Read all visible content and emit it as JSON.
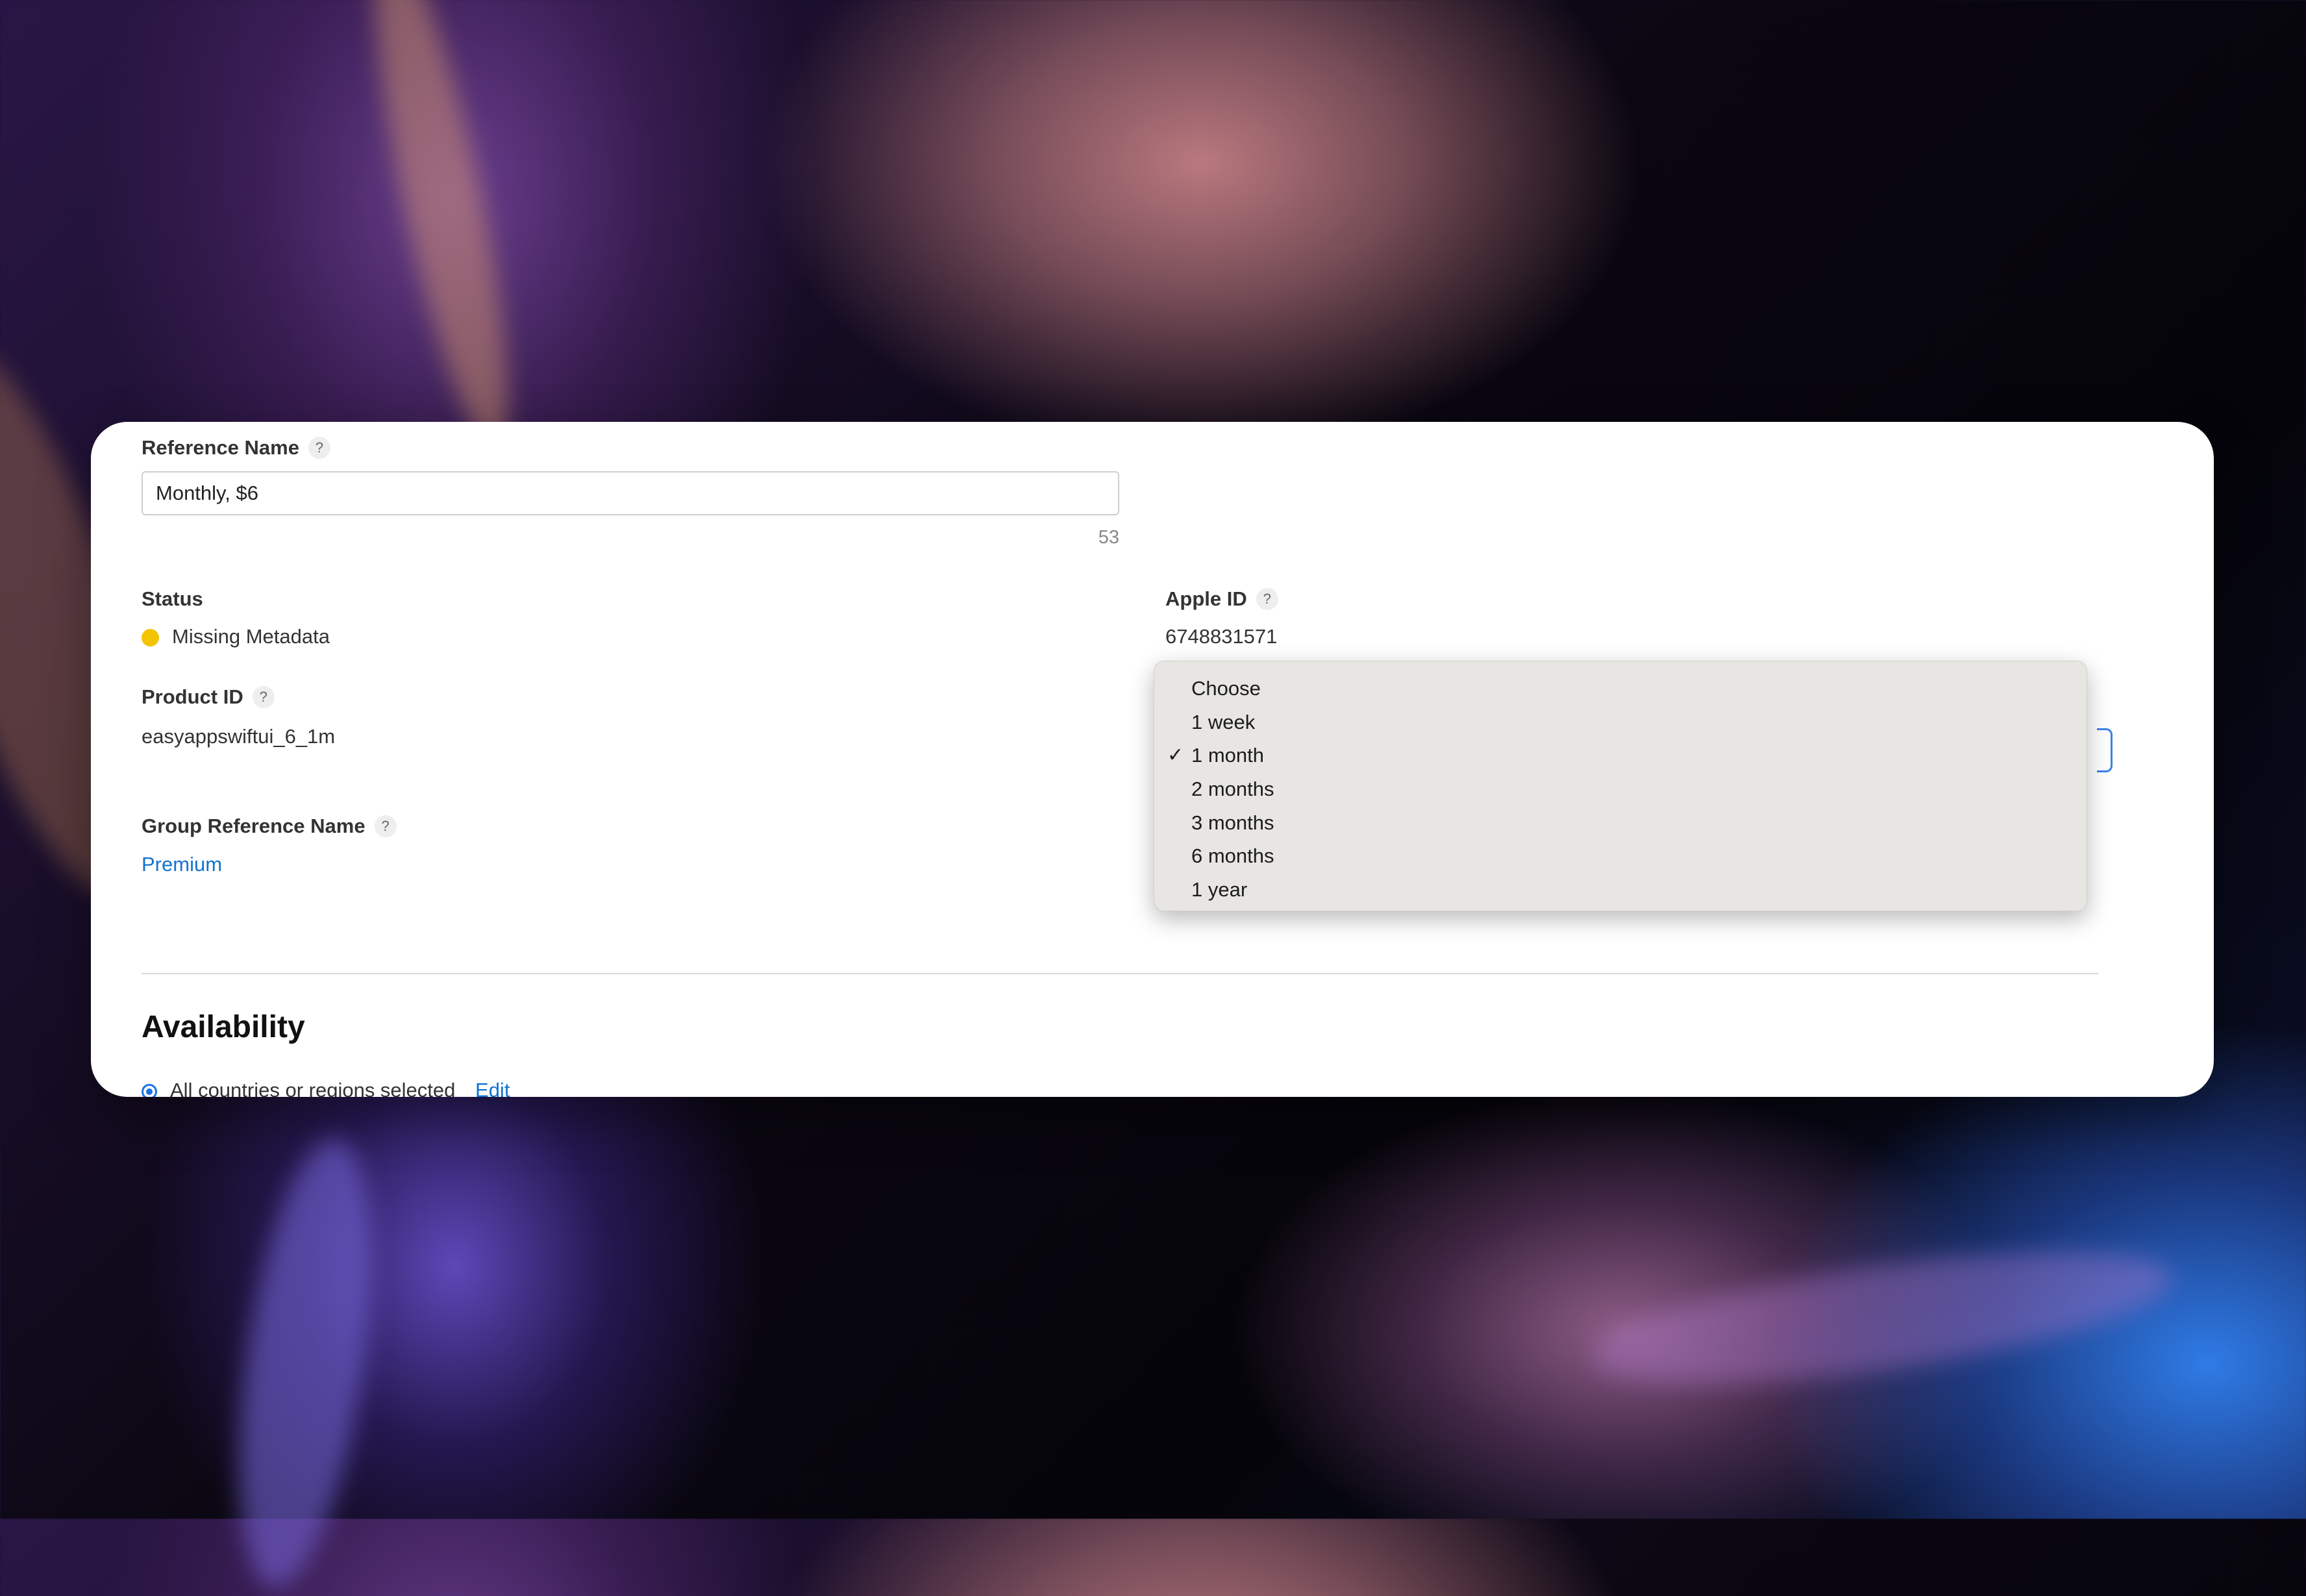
{
  "form": {
    "reference_name": {
      "label": "Reference Name",
      "value": "Monthly, $6",
      "counter": "53"
    },
    "status": {
      "label": "Status",
      "value": "Missing Metadata",
      "color": "#f5c400"
    },
    "apple_id": {
      "label": "Apple ID",
      "value": "6748831571"
    },
    "product_id": {
      "label": "Product ID",
      "value": "easyappswiftui_6_1m"
    },
    "group_reference_name": {
      "label": "Group Reference Name",
      "value": "Premium"
    },
    "help_glyph": "?"
  },
  "availability": {
    "heading": "Availability",
    "option_text": "All countries or regions selected",
    "edit_label": "Edit"
  },
  "duration_dropdown": {
    "options": [
      "Choose",
      "1 week",
      "1 month",
      "2 months",
      "3 months",
      "6 months",
      "1 year"
    ],
    "selected_index": 2,
    "check_glyph": "✓"
  },
  "colors": {
    "accent": "#1273d1",
    "focus": "#3b82e8"
  }
}
